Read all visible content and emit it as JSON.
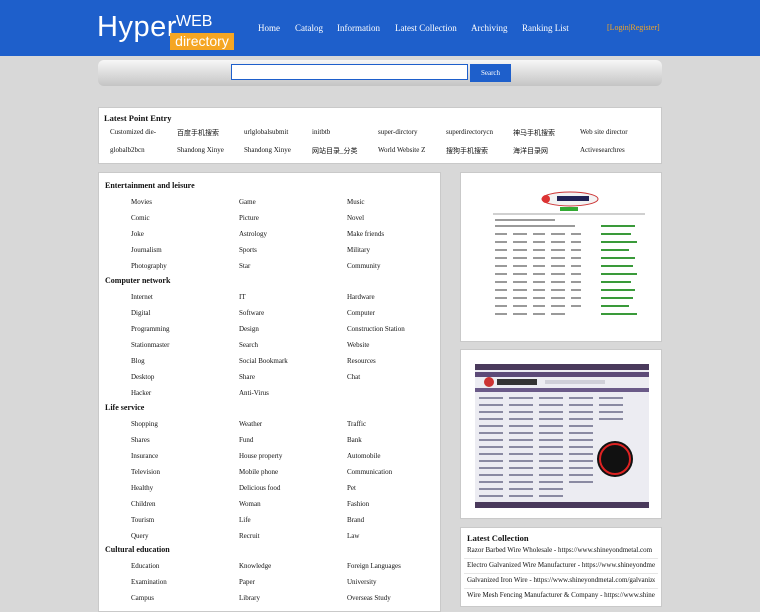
{
  "logo": {
    "hyper": "Hyper",
    "web": "WEB",
    "directory": "directory"
  },
  "nav": [
    "Home",
    "Catalog",
    "Information",
    "Latest Collection",
    "Archiving",
    "Ranking List"
  ],
  "login": "[Login|Register]",
  "search": {
    "button": "Search",
    "value": ""
  },
  "latest_point": {
    "title": "Latest Point Entry",
    "row1": [
      "Customized die-",
      "百度手机搜索",
      "urlglobalsubmit",
      "initbtb",
      "super-dirctory",
      "superdirectorycn",
      "神马手机搜索",
      "Web site director"
    ],
    "row2": [
      "globalb2bcn",
      "Shandong Xinye",
      "Shandong Xinye",
      "网站目录_分类",
      "World Website Z",
      "搜狗手机搜索",
      "海洋目录网",
      "Activesearchres"
    ]
  },
  "categories": [
    {
      "name": "Entertainment and leisure",
      "items": [
        "Movies",
        "Game",
        "Music",
        "Comic",
        "Picture",
        "Novel",
        "Joke",
        "Astrology",
        "Make friends",
        "Journalism",
        "Sports",
        "Military",
        "Photography",
        "Star",
        "Community"
      ]
    },
    {
      "name": "Computer network",
      "items": [
        "Internet",
        "IT",
        "Hardware",
        "Digital",
        "Software",
        "Computer",
        "Programming",
        "Design",
        "Construction Station",
        "Stationmaster",
        "Search",
        "Website",
        "Blog",
        "Social Bookmark",
        "Resources",
        "Desktop",
        "Share",
        "Chat",
        "Hacker",
        "Anti-Virus"
      ]
    },
    {
      "name": "Life service",
      "items": [
        "Shopping",
        "Weather",
        "Traffic",
        "Shares",
        "Fund",
        "Bank",
        "Insurance",
        "House property",
        "Automobile",
        "Television",
        "Mobile phone",
        "Communication",
        "Healthy",
        "Delicious food",
        "Pet",
        "Children",
        "Woman",
        "Fashion",
        "Tourism",
        "Life",
        "Brand",
        "Query",
        "Recruit",
        "Law"
      ]
    },
    {
      "name": "Cultural education",
      "items": [
        "Education",
        "Knowledge",
        "Foreign Languages",
        "Examination",
        "Paper",
        "University",
        "Campus",
        "Library",
        "Overseas Study"
      ]
    }
  ],
  "latest_collection": {
    "title": "Latest Collection",
    "items": [
      "Razor Barbed Wire Wholesale - https://www.shineyondmetal.com",
      "Electro Galvanized Wire Manufacturer - https://www.shineyondmetal.com",
      "Galvanized Iron Wire - https://www.shineyondmetal.com/galvanized",
      "Wire Mesh Fencing Manufacturer & Company - https://www.shineyondmetal.com"
    ]
  }
}
